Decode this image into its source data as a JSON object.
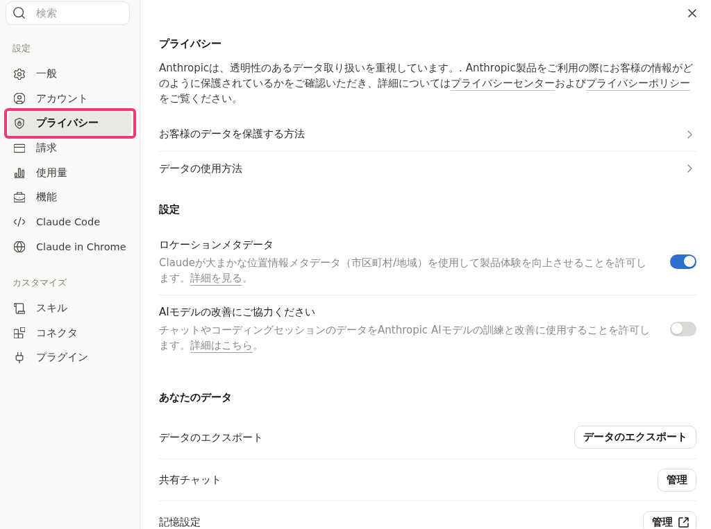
{
  "search": {
    "placeholder": "検索"
  },
  "sidebar": {
    "sections": [
      {
        "title": "設定",
        "items": [
          {
            "label": "一般",
            "selected": false,
            "highlighted": false
          },
          {
            "label": "アカウント",
            "selected": false,
            "highlighted": false
          },
          {
            "label": "プライバシー",
            "selected": true,
            "highlighted": true
          },
          {
            "label": "請求",
            "selected": false,
            "highlighted": false
          },
          {
            "label": "使用量",
            "selected": false,
            "highlighted": false
          },
          {
            "label": "機能",
            "selected": false,
            "highlighted": false
          },
          {
            "label": "Claude Code",
            "selected": false,
            "highlighted": false
          },
          {
            "label": "Claude in Chrome",
            "selected": false,
            "highlighted": false
          }
        ]
      },
      {
        "title": "カスタマイズ",
        "items": [
          {
            "label": "スキル",
            "selected": false,
            "highlighted": false
          },
          {
            "label": "コネクタ",
            "selected": false,
            "highlighted": false
          },
          {
            "label": "プラグイン",
            "selected": false,
            "highlighted": false
          }
        ]
      }
    ]
  },
  "privacy": {
    "title": "プライバシー",
    "description": [
      {
        "kind": "text",
        "text": "Anthropicは、透明性のあるデータ取り扱いを重視しています。. Anthropic製品をご利用の際にお客様の情報がどのように保護されているかをご確認いただき、詳細については"
      },
      {
        "kind": "link",
        "text": "プライバシーセンター"
      },
      {
        "kind": "text",
        "text": "および"
      },
      {
        "kind": "link",
        "text": "プライバシーポリシー"
      },
      {
        "kind": "text",
        "text": "をご覧ください。"
      }
    ],
    "links": [
      {
        "label": "お客様のデータを保護する方法"
      },
      {
        "label": "データの使用方法"
      }
    ]
  },
  "settings": {
    "title": "設定",
    "items": [
      {
        "title": "ロケーションメタデータ",
        "description": [
          {
            "kind": "text",
            "text": "Claudeが大まかな位置情報メタデータ（市区町村/地域）を使用して製品体験を向上させることを許可します。"
          },
          {
            "kind": "link",
            "text": "詳細を見る"
          },
          {
            "kind": "text",
            "text": "。"
          }
        ],
        "on": true
      },
      {
        "title": "AIモデルの改善にご協力ください",
        "description": [
          {
            "kind": "text",
            "text": "チャットやコーディングセッションのデータをAnthropic AIモデルの訓練と改善に使用することを許可します。"
          },
          {
            "kind": "link",
            "text": "詳細はこちら"
          },
          {
            "kind": "text",
            "text": "。"
          }
        ],
        "on": false
      }
    ]
  },
  "your_data": {
    "title": "あなたのデータ",
    "rows": [
      {
        "label": "データのエクスポート",
        "button": "データのエクスポート",
        "external": false
      },
      {
        "label": "共有チャット",
        "button": "管理",
        "external": false
      },
      {
        "label": "記憶設定",
        "button": "管理",
        "external": true
      }
    ]
  }
}
